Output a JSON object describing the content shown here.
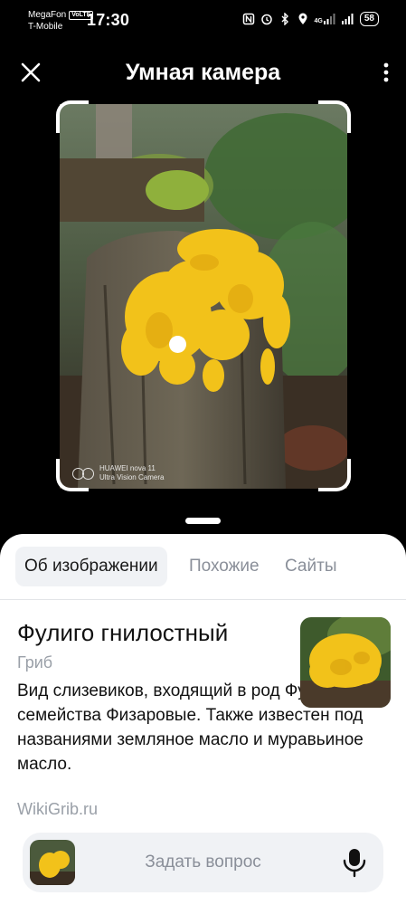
{
  "status_bar": {
    "carrier1": "MegaFon",
    "carrier1_badge": "VoLTE",
    "carrier2": "T-Mobile",
    "time": "17:30",
    "network": "4G",
    "battery": "58"
  },
  "header": {
    "title": "Умная камера",
    "close_icon": "close-icon",
    "more_icon": "more-vertical-icon"
  },
  "photo": {
    "watermark_line1": "HUAWEI nova 11",
    "watermark_line2": "Ultra Vision Camera"
  },
  "tabs": [
    {
      "label": "Об изображении",
      "active": true
    },
    {
      "label": "Похожие",
      "active": false
    },
    {
      "label": "Сайты",
      "active": false
    }
  ],
  "result": {
    "title": "Фулиго гнилостный",
    "category": "Гриб",
    "description": "Вид слизевиков, входящий в род Фулиго семейства Физаровые. Также известен под названиями земляное масло и муравьиное масло.",
    "source": "WikiGrib.ru"
  },
  "ask": {
    "placeholder": "Задать вопрос",
    "mic_icon": "microphone-icon"
  },
  "colors": {
    "accent_yellow": "#f2c21a",
    "sheet_bg": "#ffffff",
    "tab_active_bg": "#f0f2f5",
    "muted_text": "#9aa0a8"
  }
}
